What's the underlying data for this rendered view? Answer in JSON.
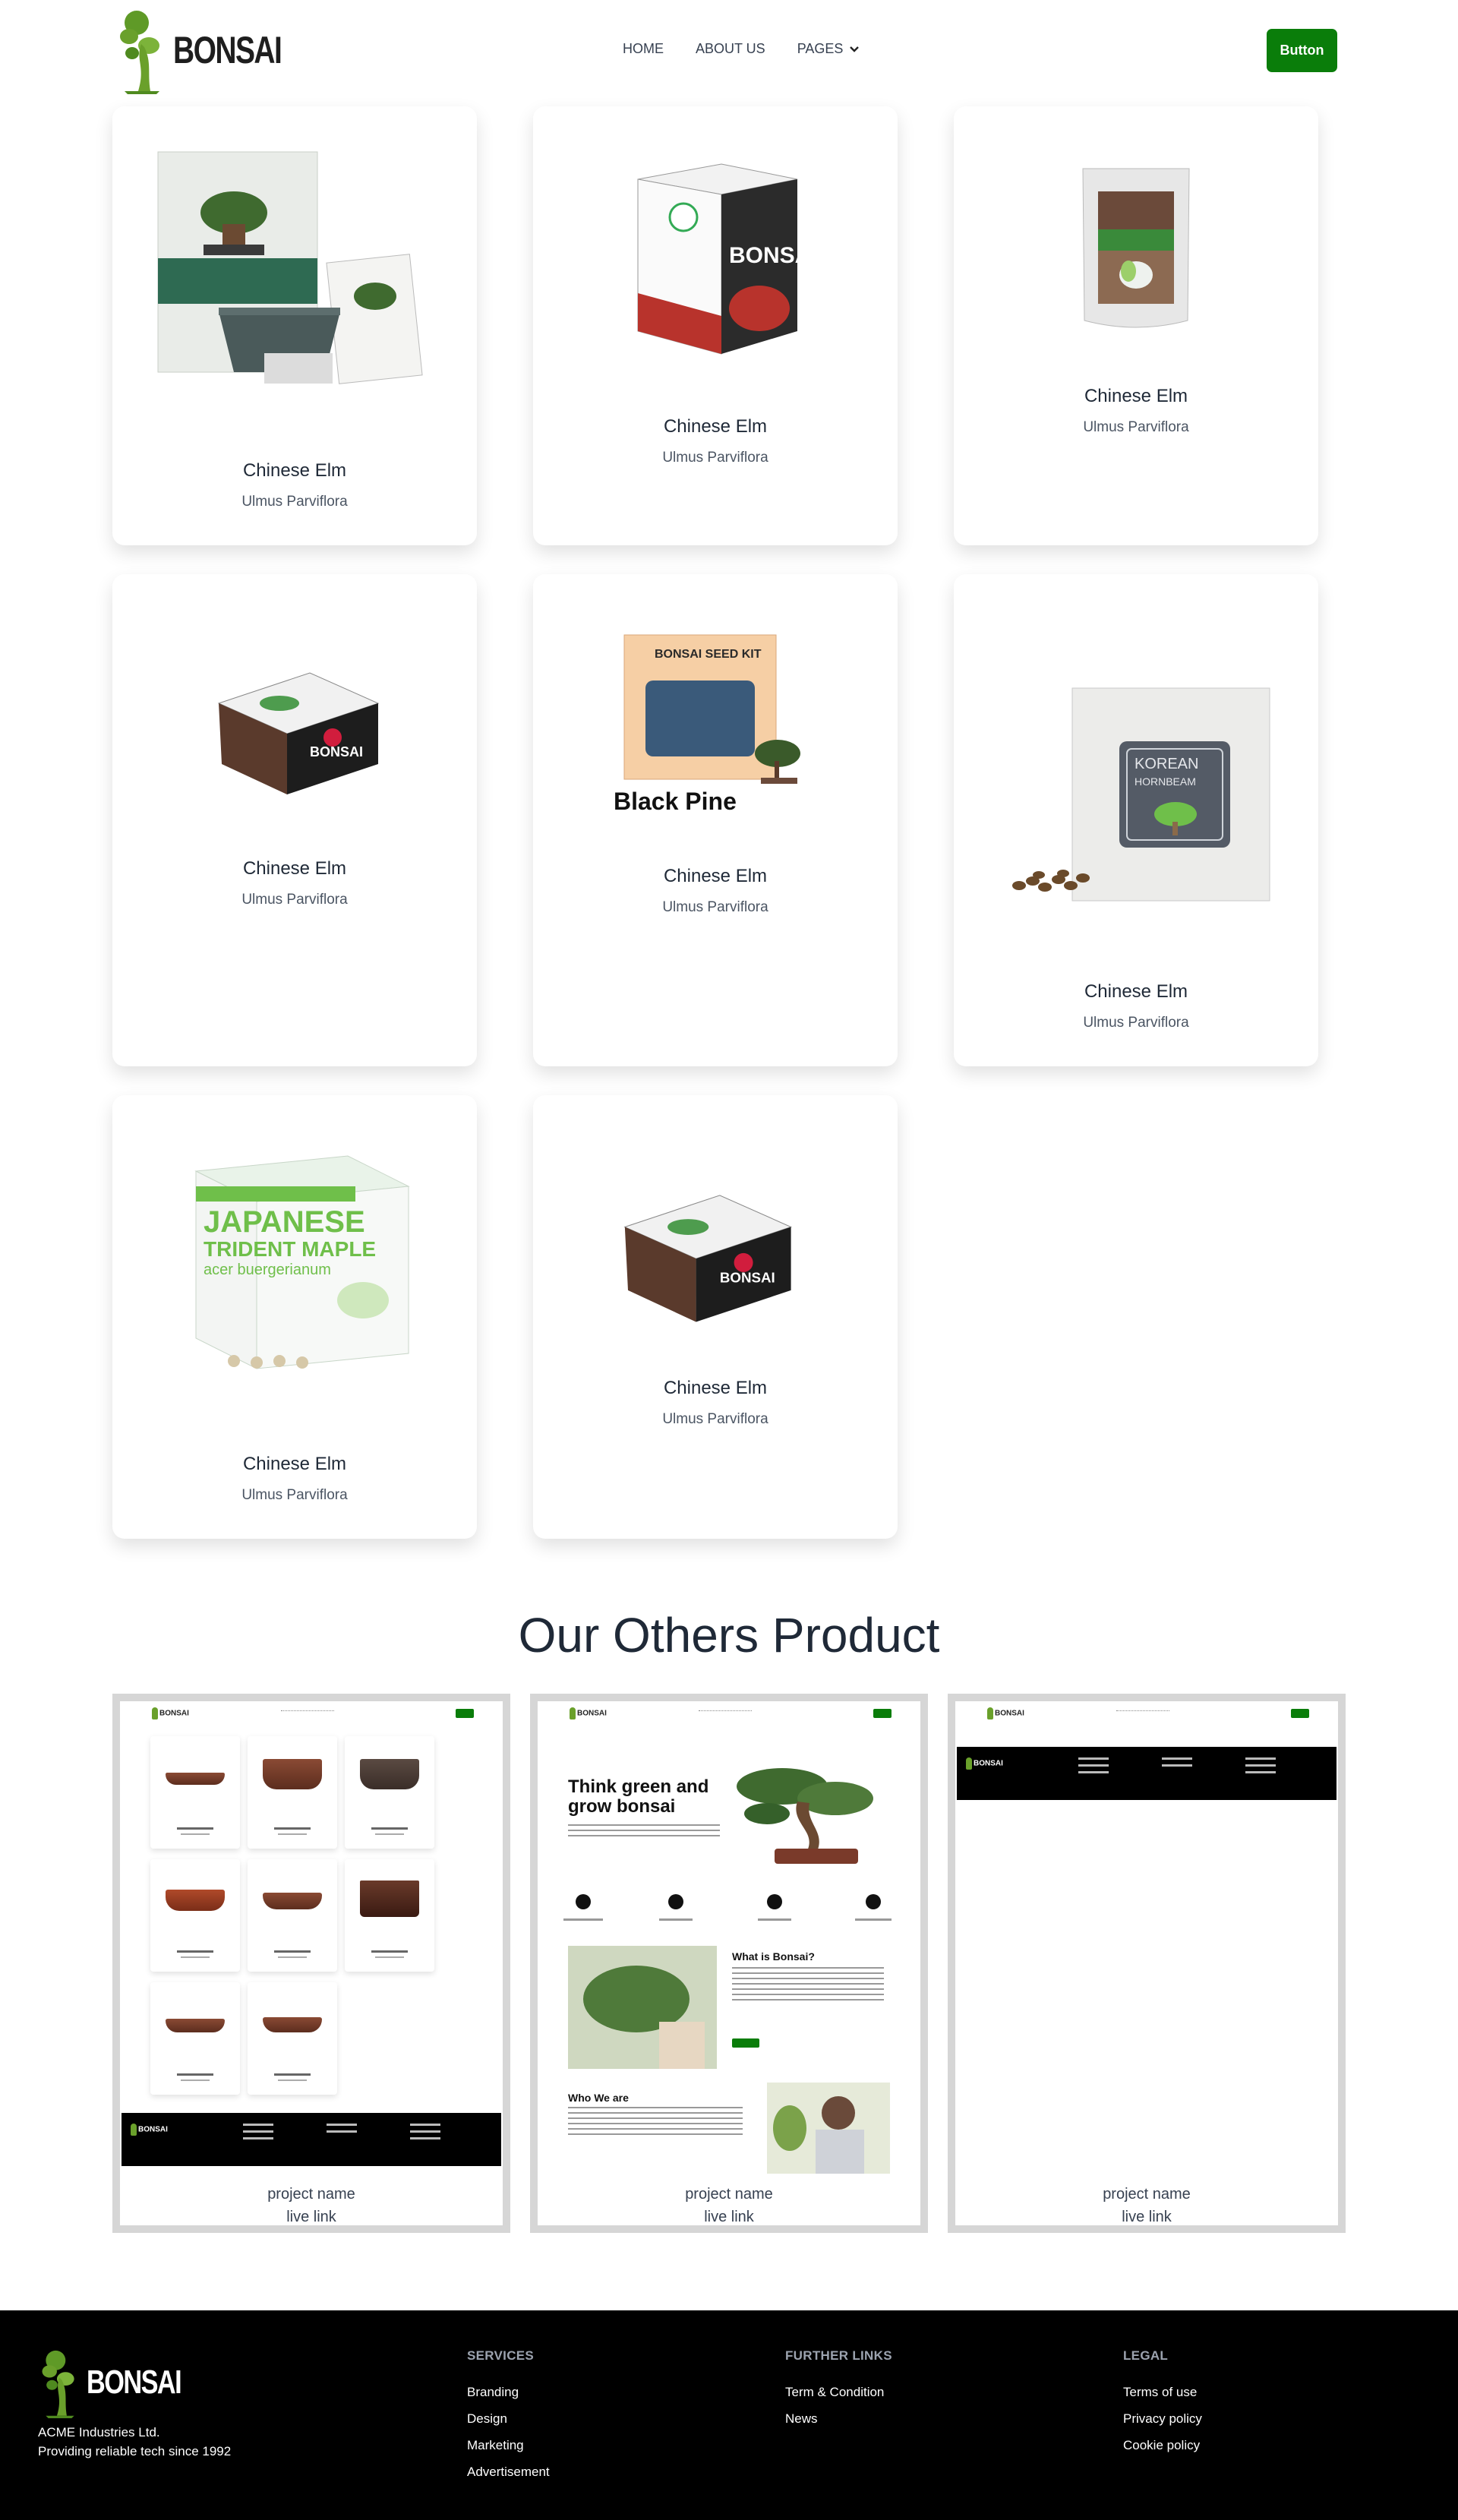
{
  "header": {
    "brand": "BONSAI",
    "menu": [
      {
        "label": "HOME"
      },
      {
        "label": "ABOUT US"
      },
      {
        "label": "PAGES"
      }
    ],
    "button_label": "Button"
  },
  "products": [
    {
      "name": "Chinese Elm",
      "sub": "Ulmus Parviflora",
      "image": "bonsai-growing-kit"
    },
    {
      "name": "Chinese Elm",
      "sub": "Ulmus Parviflora",
      "image": "bonsai-maple-box"
    },
    {
      "name": "Chinese Elm",
      "sub": "Ulmus Parviflora",
      "image": "seedling-mix-bag"
    },
    {
      "name": "Chinese Elm",
      "sub": "Ulmus Parviflora",
      "image": "bonsai-seed-box"
    },
    {
      "name": "Chinese Elm",
      "sub": "Ulmus Parviflora",
      "image": "black-pine-seed-kit",
      "image_caption": "Black Pine",
      "box_label": "BONSAI SEED KIT"
    },
    {
      "name": "Chinese Elm",
      "sub": "Ulmus Parviflora",
      "image": "korean-hornbeam-pack",
      "label_line1": "KOREAN",
      "label_line2": "HORNBEAM"
    },
    {
      "name": "Chinese Elm",
      "sub": "Ulmus Parviflora",
      "image": "japanese-trident-maple-kit",
      "label_line1": "JAPANESE",
      "label_line2": "TRIDENT MAPLE",
      "label_line3": "acer buergerianum"
    },
    {
      "name": "Chinese Elm",
      "sub": "Ulmus Parviflora",
      "image": "bonsai-seed-box"
    }
  ],
  "others": {
    "title": "Our Others Product",
    "projects": [
      {
        "name": "project name",
        "link": "live link",
        "preview": "pots-grid-page"
      },
      {
        "name": "project name",
        "link": "live link",
        "preview": "home-page",
        "hero_title": "Think green and grow bonsai",
        "about_title": "What is Bonsai?",
        "who_title": "Who We are"
      },
      {
        "name": "project name",
        "link": "live link",
        "preview": "empty-page"
      }
    ]
  },
  "footer": {
    "brand": "BONSAI",
    "company_line1": "ACME Industries Ltd.",
    "company_line2": "Providing reliable tech since 1992",
    "services": {
      "title": "SERVICES",
      "links": [
        "Branding",
        "Design",
        "Marketing",
        "Advertisement"
      ]
    },
    "further": {
      "title": "FURTHER LINKS",
      "links": [
        "Term & Condition",
        "News"
      ]
    },
    "legal": {
      "title": "LEGAL",
      "links": [
        "Terms of use",
        "Privacy policy",
        "Cookie policy"
      ]
    }
  },
  "colors": {
    "accent": "#0a7d0a",
    "logo_green": "#6aa02b",
    "footer_bg": "#000000"
  }
}
